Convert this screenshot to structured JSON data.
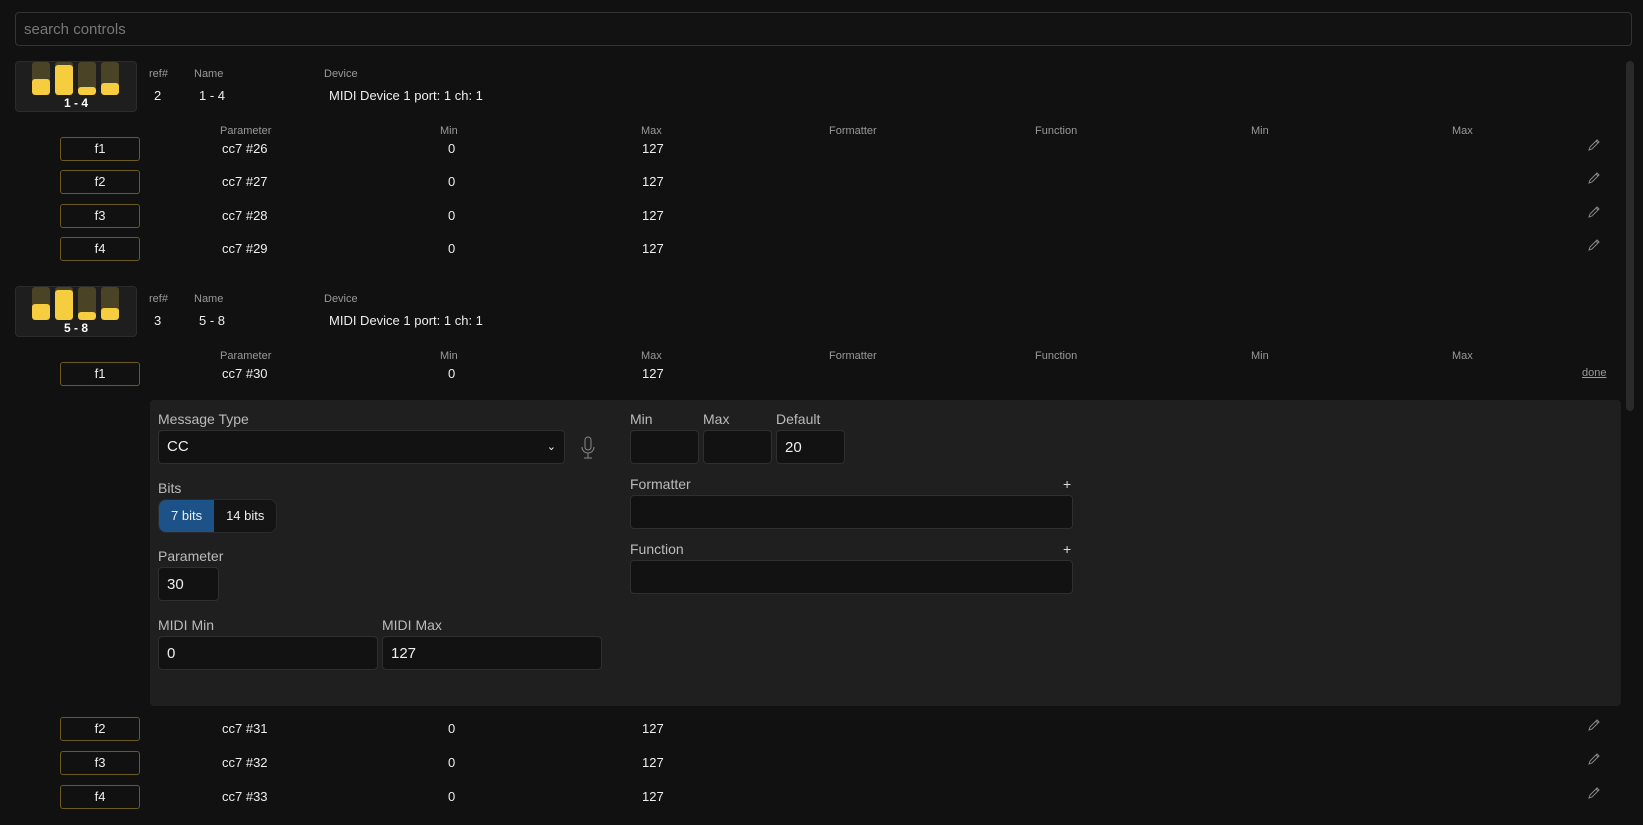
{
  "search": {
    "placeholder": "search controls"
  },
  "columns": {
    "ref": "ref#",
    "name": "Name",
    "device": "Device",
    "parameter": "Parameter",
    "min": "Min",
    "max": "Max",
    "formatter": "Formatter",
    "function": "Function",
    "min2": "Min",
    "max2": "Max"
  },
  "groups": [
    {
      "ref": "2",
      "name": "1 - 4",
      "thumb_label": "1 - 4",
      "device": "MIDI Device 1 port: 1 ch: 1",
      "levels": [
        0.5,
        0.9,
        0.25,
        0.35
      ],
      "rows": [
        {
          "label": "f1",
          "parameter": "cc7 #26",
          "min": "0",
          "max": "127"
        },
        {
          "label": "f2",
          "parameter": "cc7 #27",
          "min": "0",
          "max": "127"
        },
        {
          "label": "f3",
          "parameter": "cc7 #28",
          "min": "0",
          "max": "127"
        },
        {
          "label": "f4",
          "parameter": "cc7 #29",
          "min": "0",
          "max": "127"
        }
      ]
    },
    {
      "ref": "3",
      "name": "5 - 8",
      "thumb_label": "5 - 8",
      "device": "MIDI Device 1 port: 1 ch: 1",
      "levels": [
        0.5,
        0.9,
        0.25,
        0.35
      ],
      "rows": [
        {
          "label": "f1",
          "parameter": "cc7 #30",
          "min": "0",
          "max": "127"
        },
        {
          "label": "f2",
          "parameter": "cc7 #31",
          "min": "0",
          "max": "127"
        },
        {
          "label": "f3",
          "parameter": "cc7 #32",
          "min": "0",
          "max": "127"
        },
        {
          "label": "f4",
          "parameter": "cc7 #33",
          "min": "0",
          "max": "127"
        }
      ]
    }
  ],
  "editor": {
    "done_label": "done",
    "message_type_label": "Message Type",
    "message_type": "CC",
    "bits_label": "Bits",
    "bits_options": [
      "7 bits",
      "14 bits"
    ],
    "bits_selected": "7 bits",
    "parameter_label": "Parameter",
    "parameter": "30",
    "midi_min_label": "MIDI Min",
    "midi_min": "0",
    "midi_max_label": "MIDI Max",
    "midi_max": "127",
    "min_label": "Min",
    "min": "",
    "max_label": "Max",
    "max": "",
    "default_label": "Default",
    "default": "20",
    "formatter_label": "Formatter",
    "formatter": "",
    "function_label": "Function",
    "function": "",
    "plus": "+"
  },
  "colors": {
    "accent": "#f6cd3f",
    "selected": "#1d5288"
  }
}
